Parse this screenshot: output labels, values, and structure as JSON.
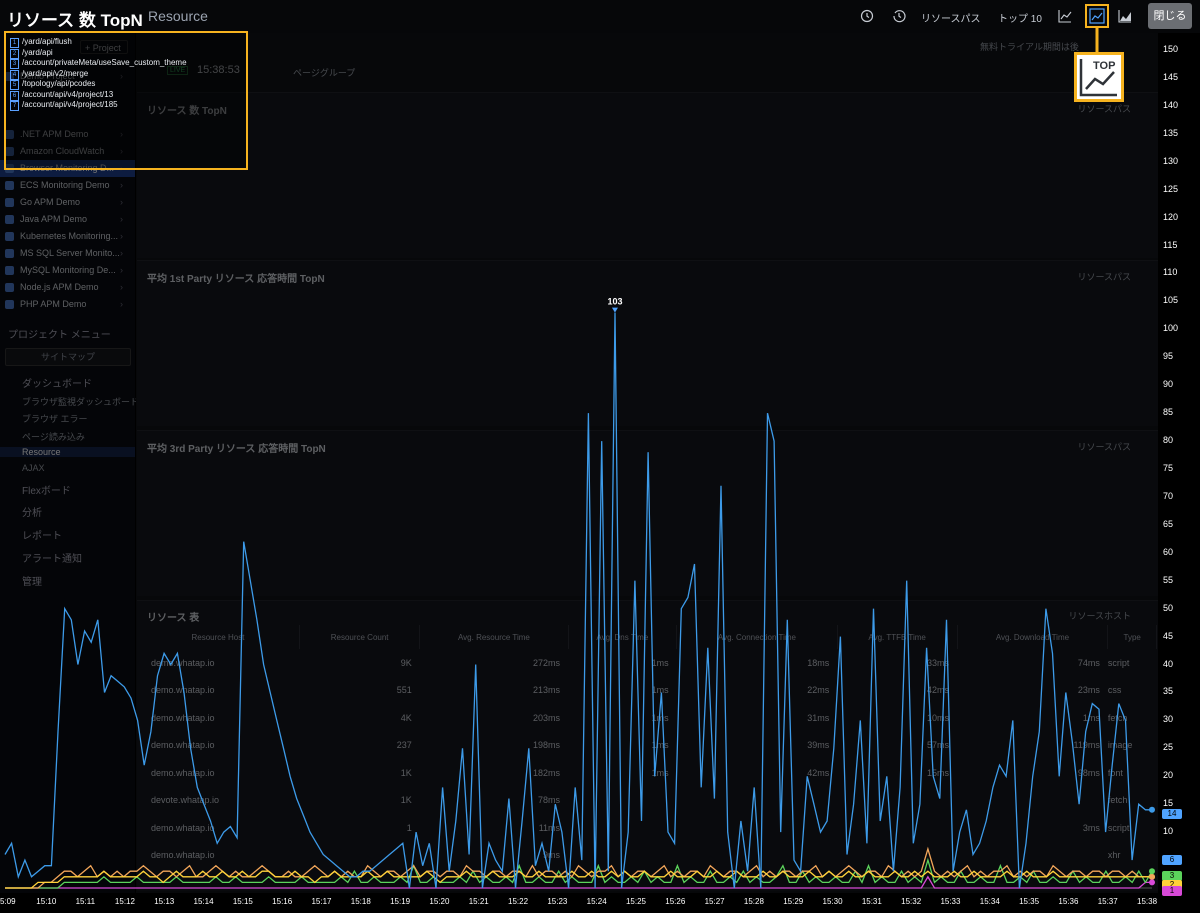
{
  "window": {
    "overlay_title": "リソース 数 TopN",
    "page_title": "Resource",
    "close_label": "閉じる"
  },
  "toolbar": {
    "resource_path_label": "リソースパス",
    "top10_label": "トップ 10",
    "icons": [
      "clock-icon",
      "history-icon",
      "line-chart-icon",
      "top-chart-icon",
      "area-chart-icon"
    ]
  },
  "trial_notice": "無料トライアル期間は後",
  "live": {
    "badge": "LIVE",
    "time": "15:38:53",
    "page_group": "ページグループ"
  },
  "tooltip": {
    "items": [
      {
        "num": "1",
        "text": "/yard/api/flush"
      },
      {
        "num": "2",
        "text": "/yard/api"
      },
      {
        "num": "3",
        "text": "/account/privateMeta/useSave_custom_theme"
      },
      {
        "num": "4",
        "text": "/yard/api/v2/merge"
      },
      {
        "num": "5",
        "text": "/topology/api/pcodes"
      },
      {
        "num": "6",
        "text": "/account/api/v4/project/13"
      },
      {
        "num": "7",
        "text": "/account/api/v4/project/185"
      }
    ]
  },
  "sidebar": {
    "add_project": "+ Project",
    "items": [
      {
        "label": "Demo Project",
        "selected": false
      },
      {
        "label": ".NET APM Demo",
        "selected": false
      },
      {
        "label": "Amazon CloudWatch",
        "selected": false
      },
      {
        "label": "Browser Monitoring D...",
        "selected": true
      },
      {
        "label": "ECS Monitoring Demo",
        "selected": false
      },
      {
        "label": "Go APM Demo",
        "selected": false
      },
      {
        "label": "Java APM Demo",
        "selected": false
      },
      {
        "label": "Kubernetes Monitoring...",
        "selected": false
      },
      {
        "label": "MS SQL Server Monito...",
        "selected": false
      },
      {
        "label": "MySQL Monitoring De...",
        "selected": false
      },
      {
        "label": "Node.js APM Demo",
        "selected": false
      },
      {
        "label": "PHP APM Demo",
        "selected": false
      }
    ],
    "menu_header": "プロジェクト メニュー",
    "sitemap": "サイトマップ",
    "sections": [
      {
        "label": "ダッシュボード"
      },
      {
        "label": "Flexボード"
      },
      {
        "label": "分析"
      },
      {
        "label": "レポート"
      },
      {
        "label": "アラート通知"
      },
      {
        "label": "管理"
      }
    ],
    "subs": [
      {
        "label": "ブラウザ監視ダッシュボード"
      },
      {
        "label": "ブラウザ エラー"
      },
      {
        "label": "ページ読み込み"
      },
      {
        "label": "Resource"
      },
      {
        "label": "AJAX"
      }
    ]
  },
  "panels": [
    {
      "title": "リソース 数 TopN",
      "link": "リソースパス"
    },
    {
      "title": "平均 1st Party リソース 応答時間 TopN",
      "link": "リソースパス"
    },
    {
      "title": "平均 3rd Party リソース 応答時間 TopN",
      "link": "リソースパス"
    },
    {
      "title": "リソース 表",
      "link": "リソースホスト"
    }
  ],
  "resource_table": {
    "headers": [
      "Resource Host",
      "Resource Count",
      "Avg. Resource Time",
      "Avg. Dns Time",
      "Avg. Connection Time",
      "Avg. TTFB Time",
      "Avg. Download Time",
      "Type"
    ],
    "rows": [
      [
        "demo.whatap.io",
        "9K",
        "272ms",
        "1ms",
        "18ms",
        "33ms",
        "74ms",
        "script"
      ],
      [
        "demo.whatap.io",
        "551",
        "213ms",
        "1ms",
        "22ms",
        "42ms",
        "23ms",
        "css"
      ],
      [
        "demo.whatap.io",
        "4K",
        "203ms",
        "1ms",
        "31ms",
        "10ms",
        "1ms",
        "fetch"
      ],
      [
        "demo.whatap.io",
        "237",
        "198ms",
        "1ms",
        "39ms",
        "57ms",
        "119ms",
        "image"
      ],
      [
        "demo.whatap.io",
        "1K",
        "182ms",
        "1ms",
        "42ms",
        "15ms",
        "98ms",
        "font"
      ],
      [
        "devote.whatap.io",
        "1K",
        "78ms",
        "",
        "",
        "",
        "",
        "fetch"
      ],
      [
        "demo.whatap.io",
        "1",
        "11ms",
        "",
        "",
        "",
        "3ms",
        "script"
      ],
      [
        "demo.whatap.io",
        "",
        "9ms",
        "",
        "",
        "",
        "",
        "xhr"
      ]
    ]
  },
  "chart_data": {
    "type": "line",
    "title": "リソース 数 TopN",
    "ylim": [
      0,
      150
    ],
    "y_ticks": [
      0,
      5,
      10,
      15,
      20,
      25,
      30,
      35,
      40,
      45,
      50,
      55,
      60,
      65,
      70,
      75,
      80,
      85,
      90,
      95,
      100,
      105,
      110,
      115,
      120,
      125,
      130,
      135,
      140,
      145,
      150
    ],
    "x_ticks": [
      "5:09",
      "15:10",
      "15:11",
      "15:12",
      "15:13",
      "15:14",
      "15:15",
      "15:16",
      "15:17",
      "15:18",
      "15:19",
      "15:20",
      "15:21",
      "15:22",
      "15:23",
      "15:24",
      "15:25",
      "15:26",
      "15:27",
      "15:28",
      "15:29",
      "15:30",
      "15:31",
      "15:32",
      "15:33",
      "15:34",
      "15:35",
      "15:36",
      "15:37",
      "15:38"
    ],
    "peak_label": "103",
    "end_values": [
      {
        "label": "14",
        "color": "#4fa3ff"
      },
      {
        "label": "6",
        "color": "#4fa3ff"
      },
      {
        "label": "3",
        "color": "#5bd35b"
      },
      {
        "label": "2",
        "color": "#ffd23a"
      },
      {
        "label": "1",
        "color": "#d84ad8"
      }
    ],
    "series": [
      {
        "color": "#3d9be9",
        "values": [
          6,
          8,
          2,
          5,
          2,
          3,
          4,
          4,
          28,
          50,
          48,
          40,
          46,
          44,
          48,
          35,
          38,
          37,
          36,
          34,
          30,
          22,
          28,
          38,
          42,
          40,
          42,
          35,
          25,
          18,
          15,
          12,
          8,
          10,
          11,
          9,
          62,
          55,
          48,
          40,
          35,
          30,
          25,
          20,
          16,
          13,
          10,
          8,
          6,
          5,
          4,
          3,
          2,
          2,
          3,
          3,
          4,
          5,
          6,
          7,
          8,
          0,
          10,
          4,
          8,
          0,
          18,
          3,
          12,
          25,
          6,
          40,
          0,
          8,
          5,
          3,
          16,
          0,
          12,
          25,
          4,
          8,
          3,
          15,
          10,
          0,
          18,
          5,
          85,
          0,
          80,
          3,
          103,
          0,
          10,
          55,
          12,
          78,
          20,
          35,
          10,
          8,
          50,
          52,
          58,
          18,
          43,
          16,
          72,
          10,
          0,
          12,
          3,
          18,
          0,
          85,
          80,
          10,
          48,
          5,
          3,
          20,
          15,
          10,
          12,
          25,
          45,
          6,
          15,
          30,
          8,
          50,
          12,
          20,
          3,
          18,
          55,
          8,
          15,
          43,
          20,
          16,
          48,
          3,
          10,
          14,
          6,
          8,
          12,
          18,
          22,
          20,
          30,
          0,
          8,
          20,
          28,
          50,
          42,
          20,
          35,
          26,
          15,
          28,
          33,
          32,
          10,
          22,
          33,
          30,
          5,
          15,
          14,
          14
        ]
      },
      {
        "color": "#ffd23a",
        "values": [
          0,
          0,
          0,
          0,
          0,
          1,
          1,
          1,
          1,
          2,
          2,
          2,
          2,
          2,
          2,
          3,
          2,
          2,
          2,
          2,
          2,
          3,
          2,
          2,
          1,
          2,
          3,
          2,
          2,
          2,
          3,
          2,
          2,
          3,
          2,
          2,
          3,
          2,
          2,
          3,
          3,
          2,
          2,
          2,
          3,
          2,
          2,
          1,
          2,
          2,
          3,
          2,
          2,
          2,
          2,
          3,
          2,
          2,
          3,
          2,
          2,
          2,
          2,
          2,
          3,
          2,
          1,
          2,
          2,
          2,
          3,
          2,
          2,
          2,
          3,
          2,
          2,
          2,
          3,
          2,
          2,
          3,
          2,
          2,
          2,
          2,
          3,
          2,
          2,
          3,
          2,
          2,
          3,
          2,
          3,
          2,
          2,
          3,
          2,
          2,
          2,
          3,
          2,
          2,
          2,
          3,
          2,
          2,
          3,
          2,
          2,
          3,
          2,
          2,
          2,
          3,
          2,
          2,
          3,
          2,
          2,
          2,
          3,
          2,
          2,
          3,
          2,
          2,
          3,
          2,
          2,
          3,
          2,
          2,
          2,
          3,
          2,
          2,
          3,
          2,
          3,
          2,
          2,
          2,
          3,
          2,
          2,
          3,
          2,
          2,
          2,
          2,
          3,
          2,
          2,
          3,
          2,
          2,
          2,
          3,
          2,
          2,
          2,
          2,
          2,
          2,
          2,
          2,
          2,
          2,
          2,
          2,
          2,
          2,
          2
        ]
      },
      {
        "color": "#f2a65a",
        "values": [
          0,
          0,
          0,
          0,
          0,
          0,
          1,
          1,
          2,
          3,
          3,
          2,
          3,
          4,
          2,
          3,
          2,
          3,
          2,
          3,
          3,
          4,
          3,
          2,
          3,
          3,
          2,
          3,
          4,
          2,
          2,
          3,
          4,
          3,
          2,
          3,
          2,
          2,
          3,
          4,
          3,
          2,
          2,
          3,
          2,
          2,
          3,
          4,
          3,
          2,
          3,
          2,
          3,
          2,
          2,
          4,
          3,
          2,
          3,
          3,
          2,
          3,
          4,
          2,
          3,
          3,
          2,
          3,
          3,
          2,
          4,
          3,
          3,
          2,
          3,
          3,
          2,
          3,
          3,
          2,
          4,
          2,
          3,
          3,
          2,
          3,
          2,
          4,
          3,
          2,
          3,
          3,
          4,
          2,
          3,
          2,
          3,
          3,
          2,
          3,
          4,
          2,
          3,
          2,
          3,
          3,
          2,
          4,
          3,
          2,
          3,
          3,
          2,
          3,
          4,
          2,
          3,
          2,
          3,
          3,
          2,
          3,
          3,
          4,
          2,
          3,
          2,
          3,
          4,
          3,
          2,
          3,
          3,
          2,
          4,
          3,
          2,
          3,
          2,
          3,
          7,
          3,
          2,
          3,
          2,
          3,
          4,
          2,
          3,
          2,
          3,
          3,
          4,
          2,
          3,
          2,
          3,
          3,
          2,
          4,
          3,
          2,
          3,
          3,
          2,
          3,
          3,
          2,
          3,
          3,
          2,
          3,
          2,
          2,
          2
        ]
      },
      {
        "color": "#5bd35b",
        "values": [
          0,
          0,
          0,
          0,
          0,
          0,
          0,
          0,
          0,
          1,
          1,
          1,
          1,
          1,
          1,
          2,
          1,
          1,
          1,
          1,
          2,
          1,
          1,
          1,
          1,
          1,
          2,
          1,
          1,
          1,
          1,
          1,
          2,
          1,
          1,
          2,
          1,
          1,
          1,
          1,
          2,
          1,
          1,
          1,
          1,
          2,
          1,
          1,
          1,
          1,
          1,
          2,
          1,
          3,
          1,
          1,
          2,
          1,
          1,
          1,
          2,
          1,
          4,
          1,
          1,
          2,
          1,
          1,
          1,
          2,
          1,
          3,
          1,
          2,
          1,
          1,
          2,
          1,
          4,
          1,
          1,
          2,
          1,
          1,
          3,
          1,
          2,
          1,
          1,
          1,
          4,
          1,
          2,
          1,
          1,
          2,
          1,
          3,
          1,
          2,
          1,
          1,
          4,
          1,
          2,
          1,
          1,
          3,
          1,
          1,
          2,
          1,
          3,
          1,
          2,
          1,
          1,
          2,
          4,
          1,
          1,
          3,
          1,
          2,
          1,
          1,
          2,
          1,
          1,
          3,
          1,
          4,
          1,
          2,
          1,
          1,
          3,
          1,
          2,
          1,
          5,
          1,
          2,
          1,
          1,
          3,
          1,
          1,
          2,
          1,
          1,
          4,
          1,
          1,
          2,
          1,
          3,
          1,
          1,
          2,
          1,
          1,
          3,
          1,
          2,
          1,
          1,
          3,
          1,
          1,
          2,
          1,
          3,
          1,
          3
        ]
      },
      {
        "color": "#d84ad8",
        "values": [
          0,
          0,
          0,
          0,
          0,
          0,
          0,
          0,
          0,
          0,
          0,
          0,
          0,
          0,
          0,
          0,
          0,
          0,
          0,
          0,
          0,
          0,
          0,
          0,
          0,
          0,
          0,
          0,
          0,
          0,
          0,
          0,
          0,
          0,
          0,
          0,
          0,
          0,
          0,
          0,
          0,
          0,
          0,
          0,
          0,
          0,
          0,
          0,
          0,
          0,
          0,
          0,
          0,
          0,
          0,
          0,
          0,
          0,
          0,
          0,
          0,
          0,
          0,
          0,
          0,
          0,
          0,
          0,
          0,
          0,
          0,
          0,
          0,
          0,
          0,
          0,
          0,
          0,
          0,
          0,
          0,
          0,
          0,
          0,
          0,
          0,
          0,
          0,
          0,
          0,
          0,
          0,
          0,
          0,
          0,
          0,
          0,
          0,
          0,
          0,
          0,
          0,
          0,
          0,
          0,
          0,
          0,
          0,
          0,
          0,
          0,
          0,
          0,
          0,
          0,
          0,
          0,
          0,
          0,
          0,
          0,
          0,
          0,
          0,
          0,
          0,
          0,
          0,
          0,
          0,
          0,
          0,
          0,
          0,
          0,
          0,
          0,
          0,
          0,
          0,
          2,
          0,
          0,
          0,
          0,
          0,
          0,
          0,
          0,
          0,
          0,
          0,
          0,
          0,
          0,
          0,
          0,
          0,
          0,
          0,
          0,
          0,
          0,
          0,
          0,
          0,
          0,
          0,
          0,
          0,
          0,
          0,
          0,
          1,
          1
        ]
      }
    ]
  }
}
